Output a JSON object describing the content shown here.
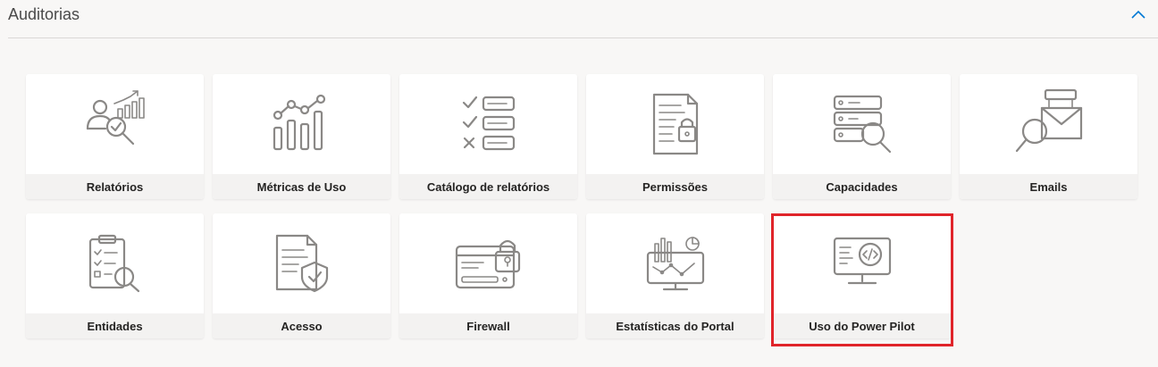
{
  "section": {
    "title": "Auditorias",
    "collapse_icon": "chevron-up-icon"
  },
  "tiles": [
    {
      "label": "Relatórios",
      "icon": "report-analytics-icon"
    },
    {
      "label": "Métricas de Uso",
      "icon": "usage-metrics-chart-icon"
    },
    {
      "label": "Catálogo de relatórios",
      "icon": "checklist-catalog-icon"
    },
    {
      "label": "Permissões",
      "icon": "document-lock-icon"
    },
    {
      "label": "Capacidades",
      "icon": "server-search-icon"
    },
    {
      "label": "Emails",
      "icon": "email-search-icon"
    },
    {
      "label": "Entidades",
      "icon": "clipboard-search-icon"
    },
    {
      "label": "Acesso",
      "icon": "document-shield-icon"
    },
    {
      "label": "Firewall",
      "icon": "firewall-lock-icon"
    },
    {
      "label": "Estatísticas do Portal",
      "icon": "portal-stats-monitor-icon"
    },
    {
      "label": "Uso do Power Pilot",
      "icon": "code-monitor-icon"
    }
  ],
  "colors": {
    "highlight": "#e0242a",
    "icon": "#8a8886",
    "accent": "#0078d4"
  }
}
